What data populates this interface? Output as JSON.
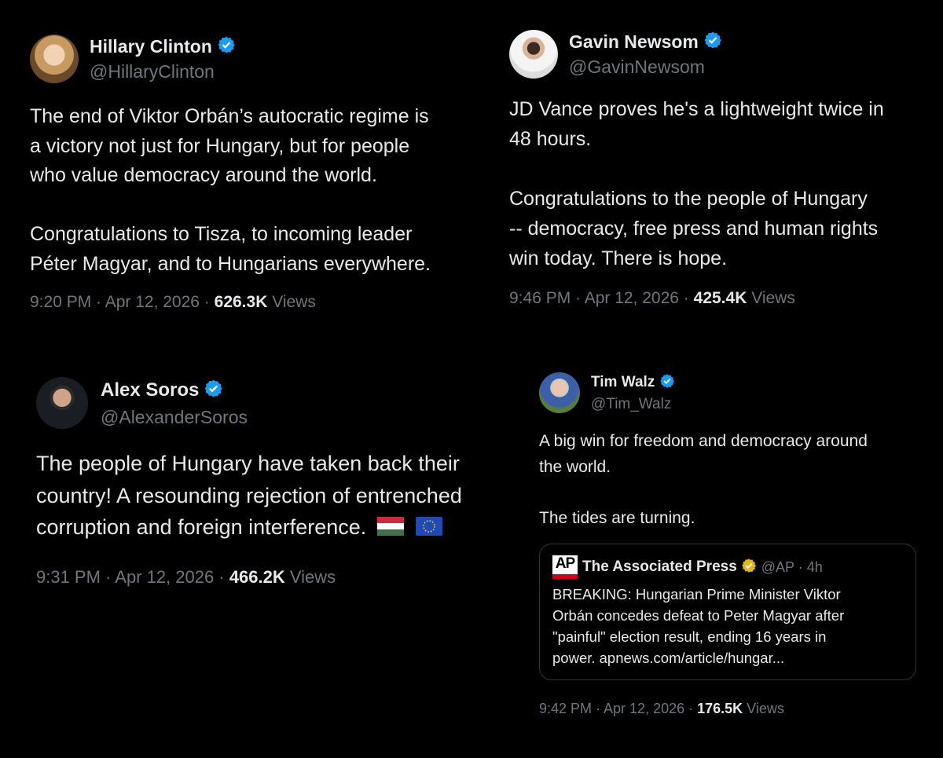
{
  "colors": {
    "background": "#000000",
    "text": "#e7e9ea",
    "muted": "#71767b",
    "verified_blue": "#1d9bf0",
    "verified_gold": "#e2b719",
    "ap_red": "#d0021b"
  },
  "tweets": [
    {
      "name": "Hillary Clinton",
      "handle": "@HillaryClinton",
      "text": "The end of Viktor Orbán’s autocratic regime is\na victory not just for Hungary, but for people\nwho value democracy around the world.\n\nCongratulations to Tisza, to incoming leader\nPéter Magyar, and to Hungarians everywhere.",
      "time": "9:20 PM · Apr 12, 2026 · ",
      "views_count": "626.3K",
      "views_label": " Views"
    },
    {
      "name": "Gavin Newsom",
      "handle": "@GavinNewsom",
      "text": "JD Vance proves he's a lightweight twice in\n48 hours.\n\nCongratulations to the people of Hungary\n-- democracy, free press and human rights\nwin today. There is hope.",
      "time": "9:46 PM · Apr 12, 2026 · ",
      "views_count": "425.4K",
      "views_label": " Views"
    },
    {
      "name": "Alex Soros",
      "handle": "@AlexanderSoros",
      "text": "The people of Hungary have taken back their\ncountry! A resounding rejection of entrenched\ncorruption and foreign interference.",
      "time": "9:31 PM · Apr 12, 2026 · ",
      "views_count": "466.2K",
      "views_label": " Views"
    },
    {
      "name": "Tim Walz",
      "handle": "@Tim_Walz",
      "text": "A big win for freedom and democracy around\nthe world.\n\nThe tides are turning.",
      "time": "9:42 PM · Apr 12, 2026 · ",
      "views_count": "176.5K",
      "views_label": " Views",
      "quote": {
        "logo": "AP",
        "name": "The Associated Press",
        "handle": "@AP · 4h",
        "text": "BREAKING: Hungarian Prime Minister Viktor\nOrbán concedes defeat to Peter Magyar after\n\"painful\" election result, ending 16 years in\npower. apnews.com/article/hungar..."
      }
    }
  ],
  "icons": {
    "verified": "verified-badge-icon",
    "flag_hu": "hungary-flag-icon",
    "flag_eu": "eu-flag-icon"
  }
}
